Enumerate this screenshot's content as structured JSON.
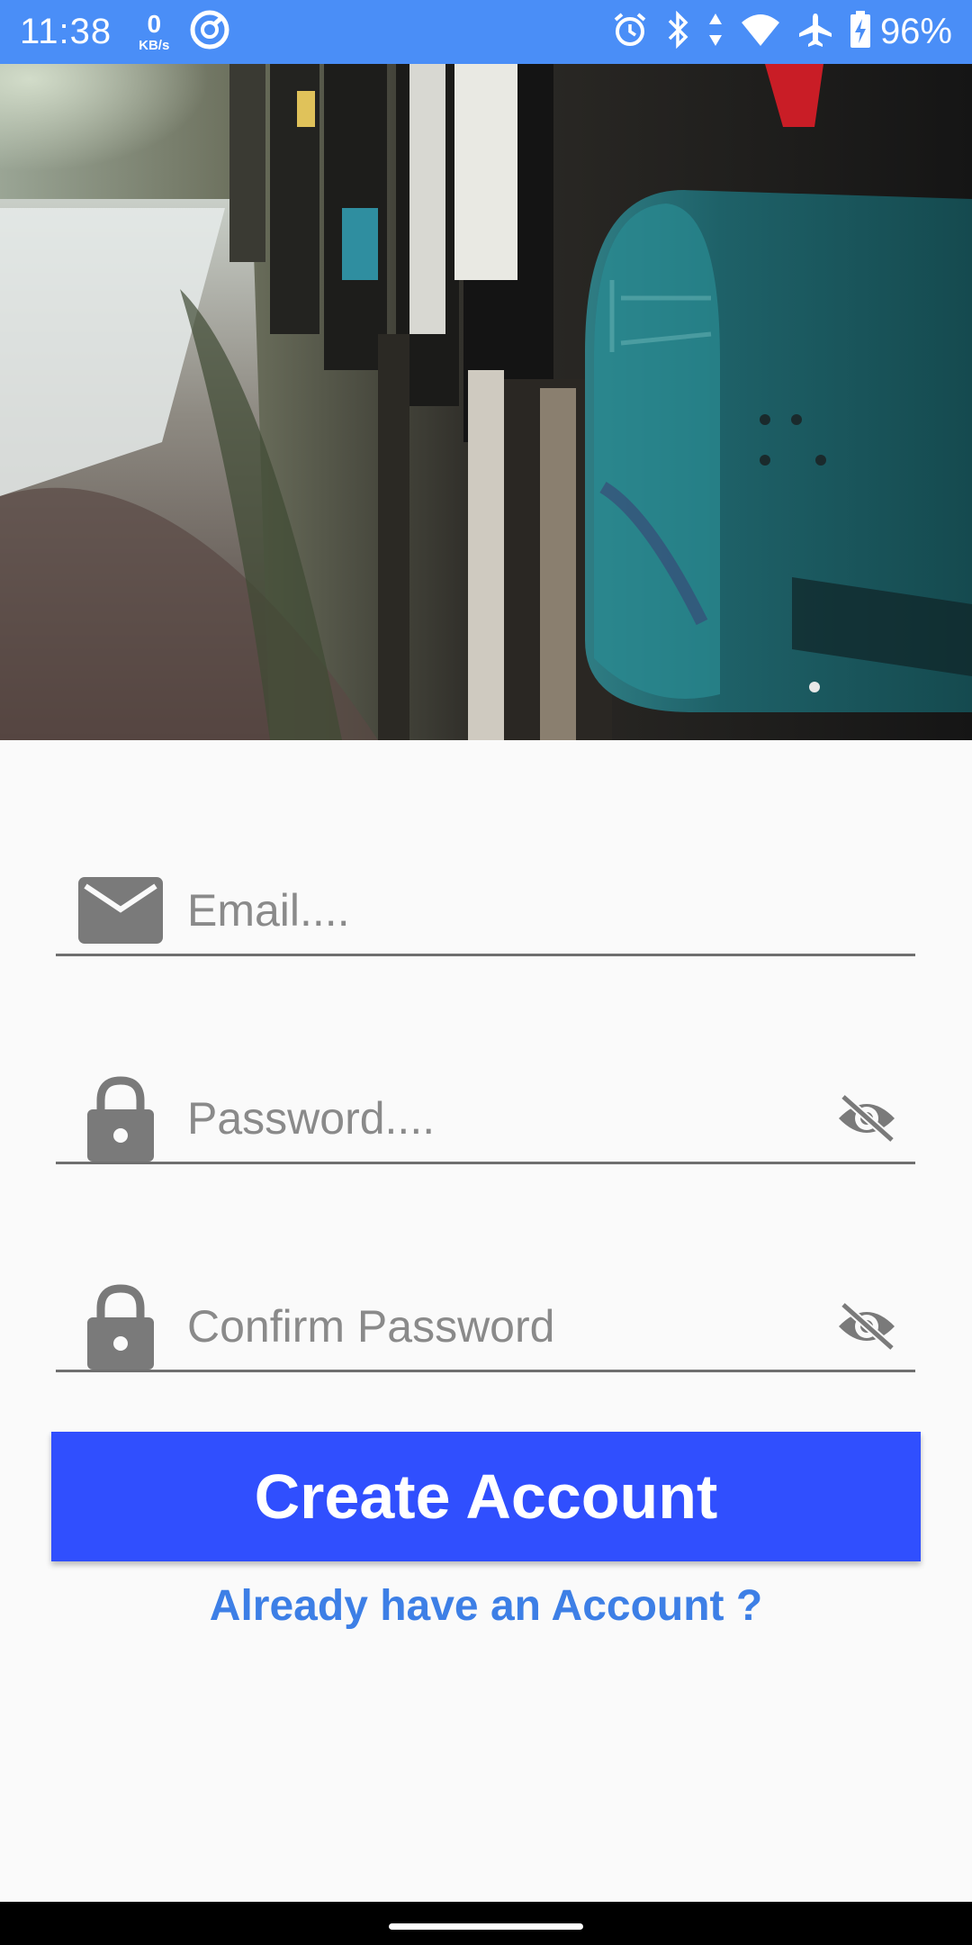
{
  "status_bar": {
    "time": "11:38",
    "net_speed_value": "0",
    "net_speed_unit": "KB/s",
    "battery": "96%",
    "icons": [
      "alarm-icon",
      "bluetooth-icon",
      "data-arrows-icon",
      "wifi-icon",
      "airplane-icon",
      "battery-charging-icon"
    ]
  },
  "hero": {
    "description_icon": "mailbox-photo"
  },
  "form": {
    "email": {
      "placeholder": "Email....",
      "icon": "email-icon"
    },
    "password": {
      "placeholder": "Password....",
      "icon": "lock-icon",
      "toggle_icon": "visibility-off-icon"
    },
    "confirm_password": {
      "placeholder": "Confirm Password",
      "icon": "lock-icon",
      "toggle_icon": "visibility-off-icon"
    },
    "submit_label": "Create Account",
    "login_link": "Already have an Account ?"
  },
  "colors": {
    "status_bar": "#4a8ef7",
    "button": "#304ffe",
    "link": "#3d7fe6",
    "icon_gray": "#7a7a7a"
  }
}
